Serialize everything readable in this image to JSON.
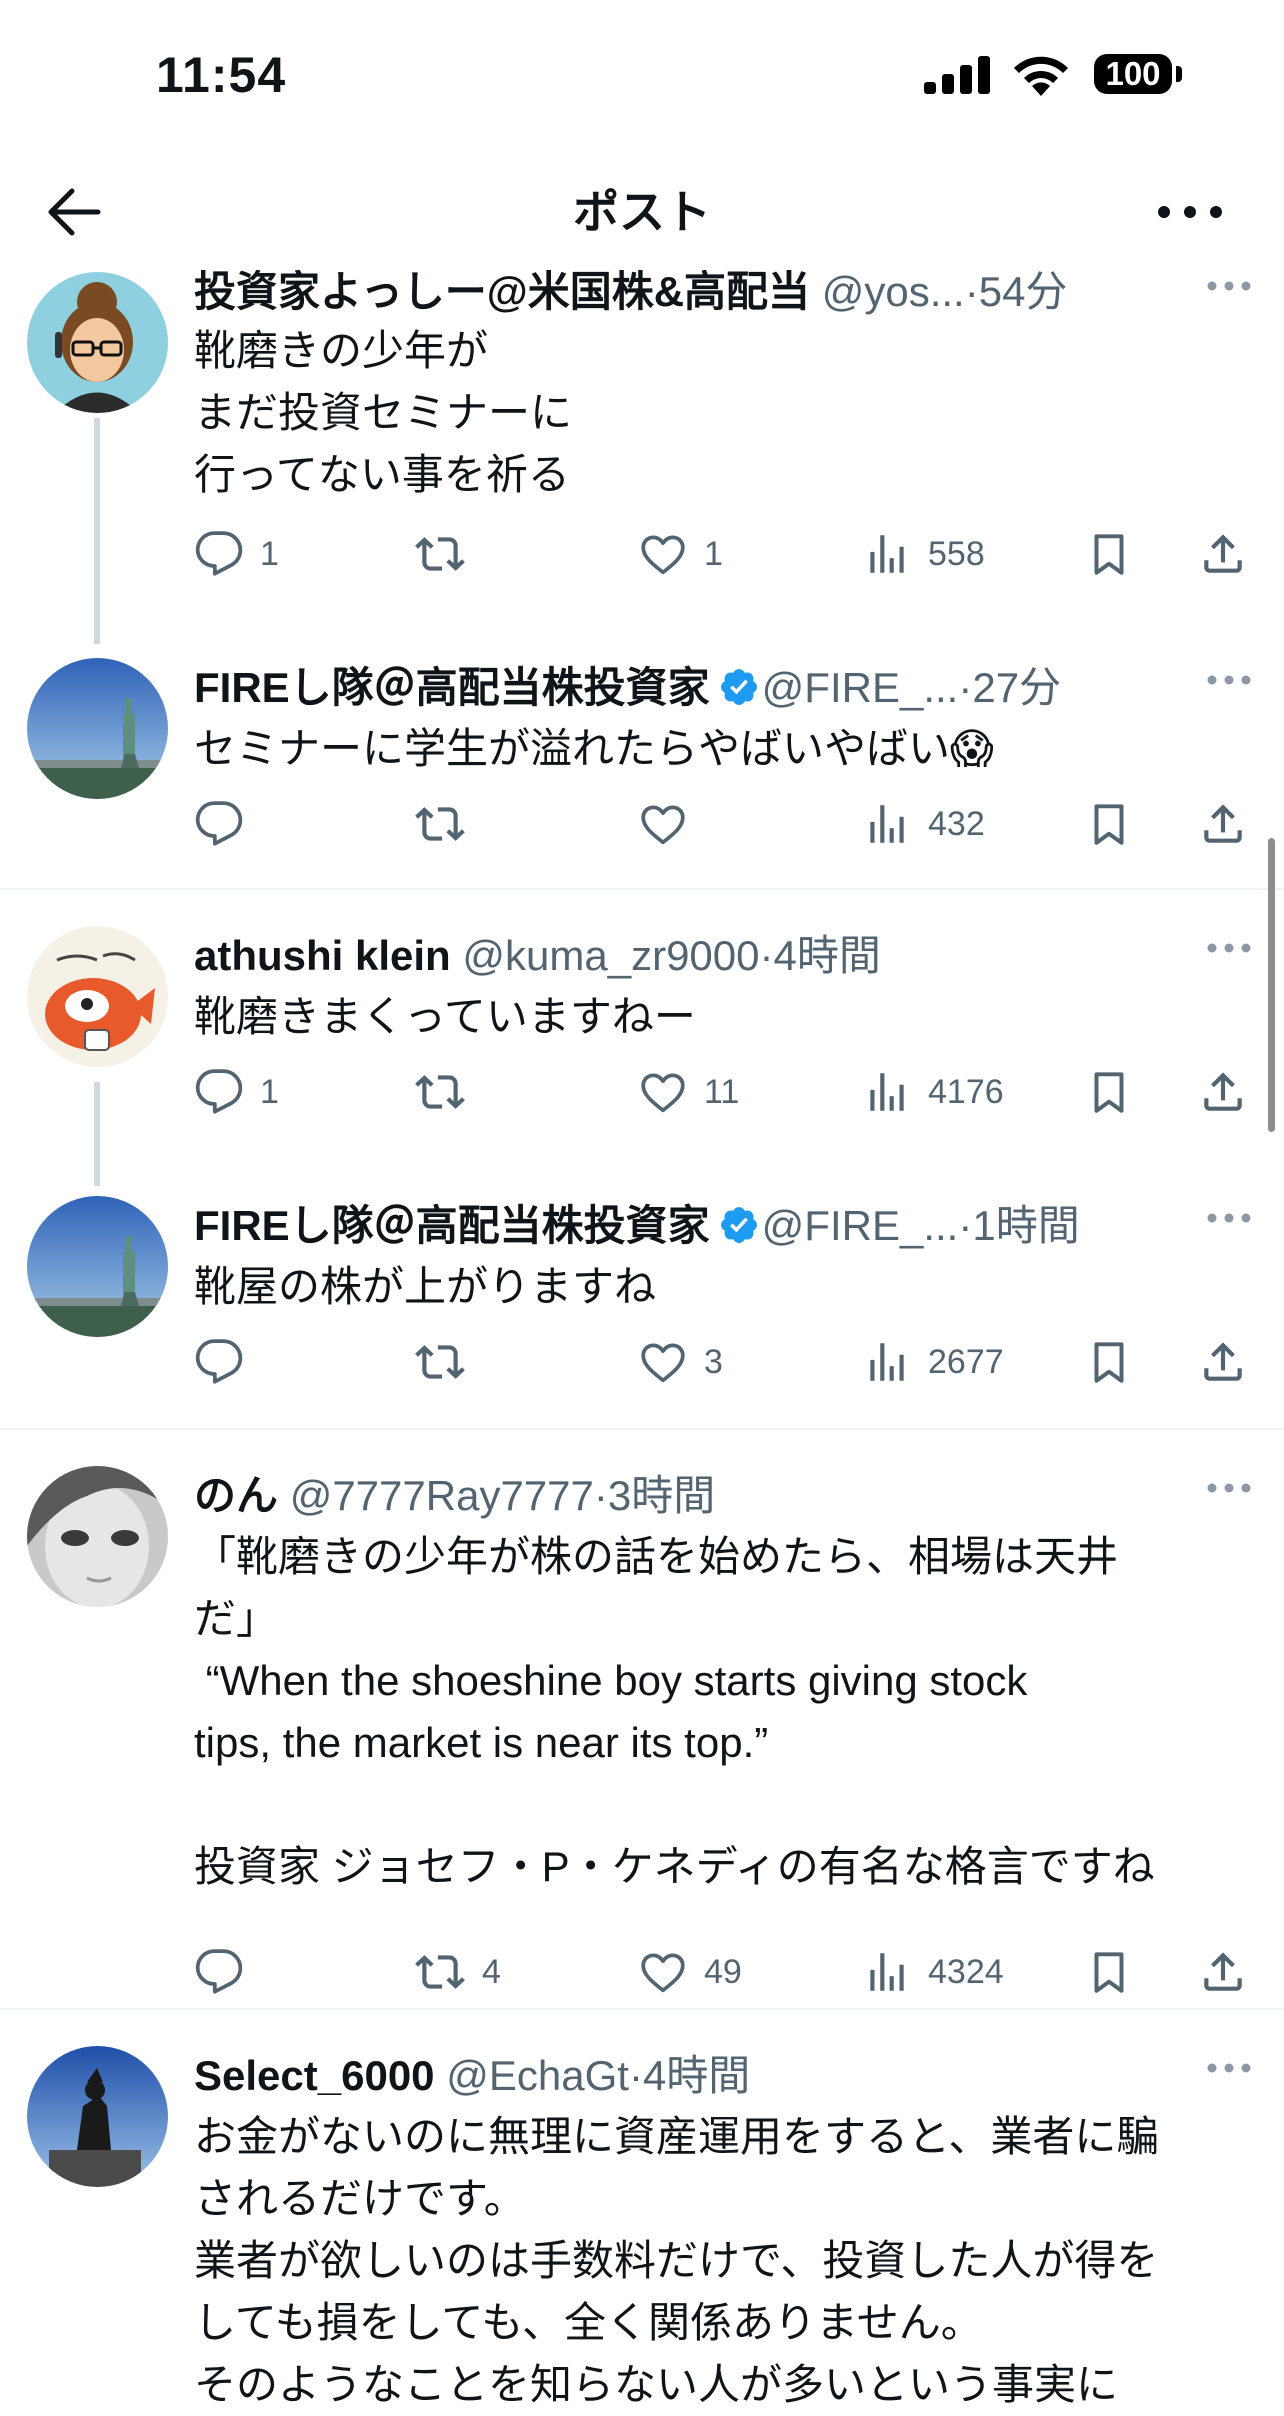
{
  "status_bar": {
    "time": "11:54",
    "battery": "100"
  },
  "header": {
    "title": "ポスト"
  },
  "posts": [
    {
      "name": "投資家よっしー@米国株&高配当",
      "handle": "@yos...",
      "sep": "·",
      "time": "54分",
      "text": "靴磨きの少年が\nまだ投資セミナーに\n行ってない事を祈る",
      "reply_count": "1",
      "retweet_count": "",
      "like_count": "1",
      "view_count": "558"
    },
    {
      "name": "FIREし隊＠高配当株投資家",
      "handle": "@FIRE_...",
      "sep": "·",
      "time": "27分",
      "text": "セミナーに学生が溢れたらやばいやばい😱",
      "reply_count": "",
      "retweet_count": "",
      "like_count": "",
      "view_count": "432"
    },
    {
      "name": "athushi klein",
      "handle": "@kuma_zr9000",
      "sep": "·",
      "time": "4時間",
      "text": "靴磨きまくっていますねー",
      "reply_count": "1",
      "retweet_count": "",
      "like_count": "11",
      "view_count": "4176"
    },
    {
      "name": "FIREし隊＠高配当株投資家",
      "handle": "@FIRE_...",
      "sep": "·",
      "time": "1時間",
      "text": "靴屋の株が上がりますね",
      "reply_count": "",
      "retweet_count": "",
      "like_count": "3",
      "view_count": "2677"
    },
    {
      "name": "のん",
      "handle": "@7777Ray7777",
      "sep": "·",
      "time": "3時間",
      "text": "「靴磨きの少年が株の話を始めたら、相場は天井\nだ」\n “When the shoeshine boy starts giving stock\ntips, the market is near its top.”\n\n投資家 ジョセフ・P・ケネディの有名な格言ですね",
      "reply_count": "",
      "retweet_count": "4",
      "like_count": "49",
      "view_count": "4324"
    },
    {
      "name": "Select_6000",
      "handle": "@EchaGt",
      "sep": "·",
      "time": "4時間",
      "text": "お金がないのに無理に資産運用をすると、業者に騙\nされるだけです。\n業者が欲しいのは手数料だけで、投資した人が得を\nしても損をしても、全く関係ありません。\nそのようなことを知らない人が多いという事実に",
      "reply_count": "",
      "retweet_count": "",
      "like_count": "",
      "view_count": ""
    }
  ],
  "colors": {
    "text": "#0f1419",
    "secondary": "#536471",
    "verified": "#1d9bf0",
    "thread_line": "#cfd9de",
    "divider": "#eff3f4"
  }
}
